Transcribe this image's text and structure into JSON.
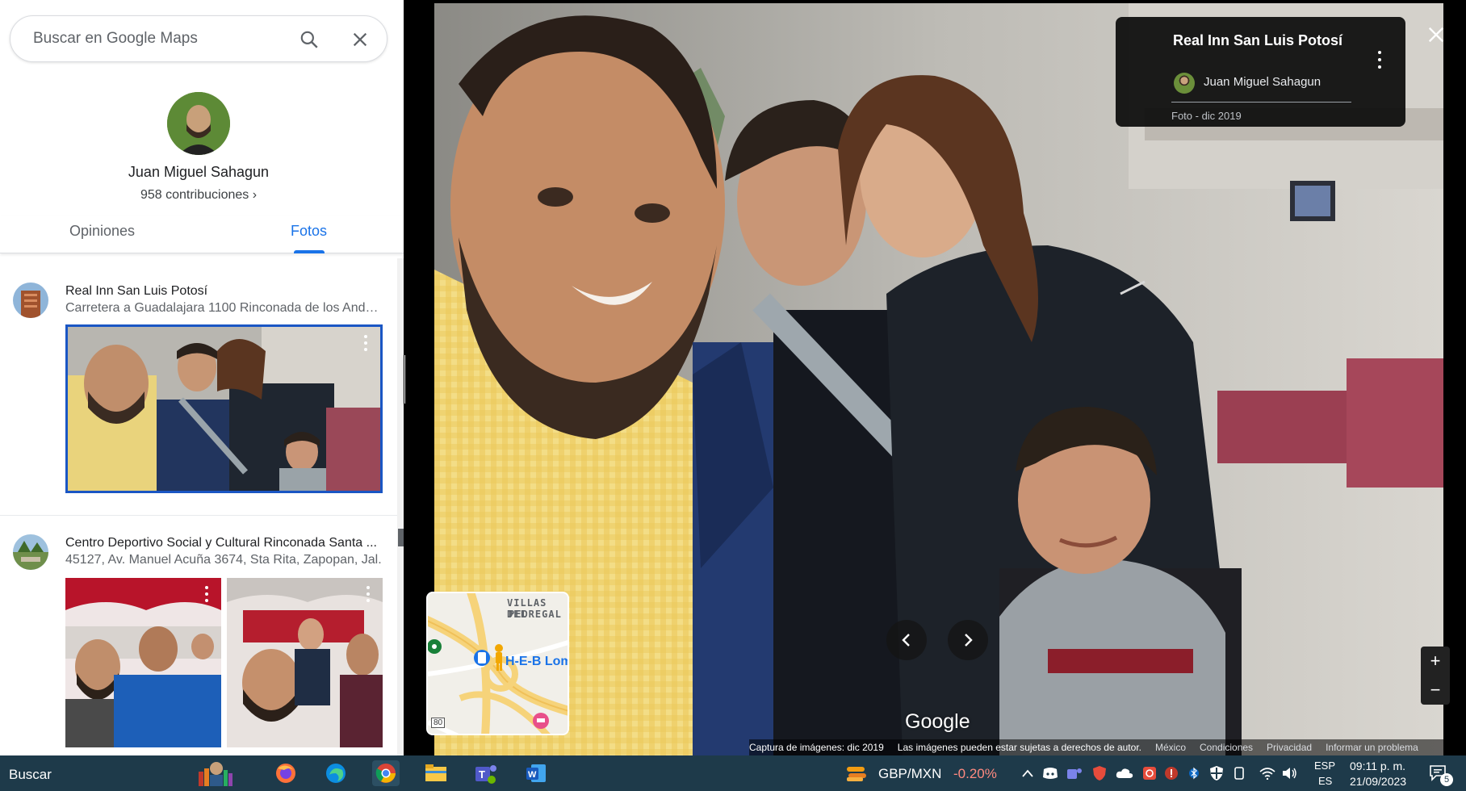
{
  "search": {
    "placeholder": "Buscar en Google Maps"
  },
  "profile": {
    "name": "Juan Miguel Sahagun",
    "contributions": "958 contribuciones ›"
  },
  "tabs": [
    {
      "label": "Opiniones"
    },
    {
      "label": "Fotos"
    }
  ],
  "entries": [
    {
      "title": "Real Inn San Luis Potosí",
      "address": "Carretera a Guadalajara 1100 Rinconada de los Ande..."
    },
    {
      "title": "Centro Deportivo Social y Cultural Rinconada Santa ...",
      "address": "45127, Av. Manuel Acuña 3674, Sta Rita, Zapopan, Jal."
    }
  ],
  "viewer": {
    "place": "Real Inn San Luis Potosí",
    "author": "Juan Miguel Sahagun",
    "date": "Foto - dic 2019",
    "logo": "Google"
  },
  "minimap": {
    "label1": "VILLAS DEL",
    "label2": "PEDREGAL",
    "label3": "H-E-B Loma",
    "shield": "80"
  },
  "attribution": {
    "capture": "Captura de imágenes: dic 2019",
    "rights": "Las imágenes pueden estar sujetas a derechos de autor.",
    "country": "México",
    "terms": "Condiciones",
    "privacy": "Privacidad",
    "report": "Informar un problema"
  },
  "taskbar": {
    "search": "Buscar",
    "currency": "GBP/MXN",
    "change": "-0.20%",
    "lang1": "ESP",
    "lang2": "ES",
    "time": "09:11 p. m.",
    "date": "21/09/2023",
    "notif_count": "5"
  },
  "colors": {
    "accent": "#1a73e8",
    "taskbar": "#1e3a4a",
    "negative": "#ff8a80"
  }
}
